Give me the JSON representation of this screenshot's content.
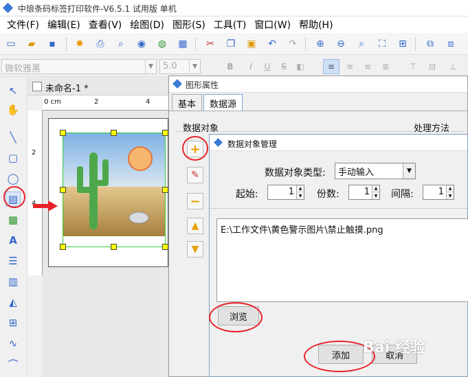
{
  "window": {
    "title": "中琅条码标签打印软件-V6.5.1 试用版 单机"
  },
  "menu": [
    "文件(F)",
    "编辑(E)",
    "查看(V)",
    "绘图(D)",
    "图形(S)",
    "工具(T)",
    "窗口(W)",
    "帮助(H)"
  ],
  "fontbar": {
    "font_name": "微软雅黑",
    "font_size": "5.0",
    "bold": "B",
    "italic": "I",
    "underline": "U",
    "strike": "S"
  },
  "doc_tab": {
    "label": "未命名-1 *"
  },
  "ruler": {
    "origin": "0 cm",
    "mark_2": "2",
    "mark_4": "4",
    "v_2": "2",
    "v_4": "4"
  },
  "property_dialog": {
    "title": "图形属性",
    "tabs": [
      "基本",
      "数据源"
    ],
    "data_object_group": "数据对象",
    "processing_group": "处理方法"
  },
  "data_manager": {
    "title": "数据对象管理",
    "type_label": "数据对象类型:",
    "type_value": "手动输入",
    "start_label": "起始:",
    "start_value": "1",
    "copies_label": "份数:",
    "copies_value": "1",
    "interval_label": "间隔:",
    "interval_value": "1",
    "path_value": "E:\\工作文件\\黄色警示图片\\禁止触摸.png",
    "browse_label": "浏览",
    "add_label": "添加",
    "cancel_label": "取消"
  },
  "colors": {
    "highlight": "#e8222a",
    "accent": "#3a7bd5",
    "selection": "#33cc33"
  }
}
